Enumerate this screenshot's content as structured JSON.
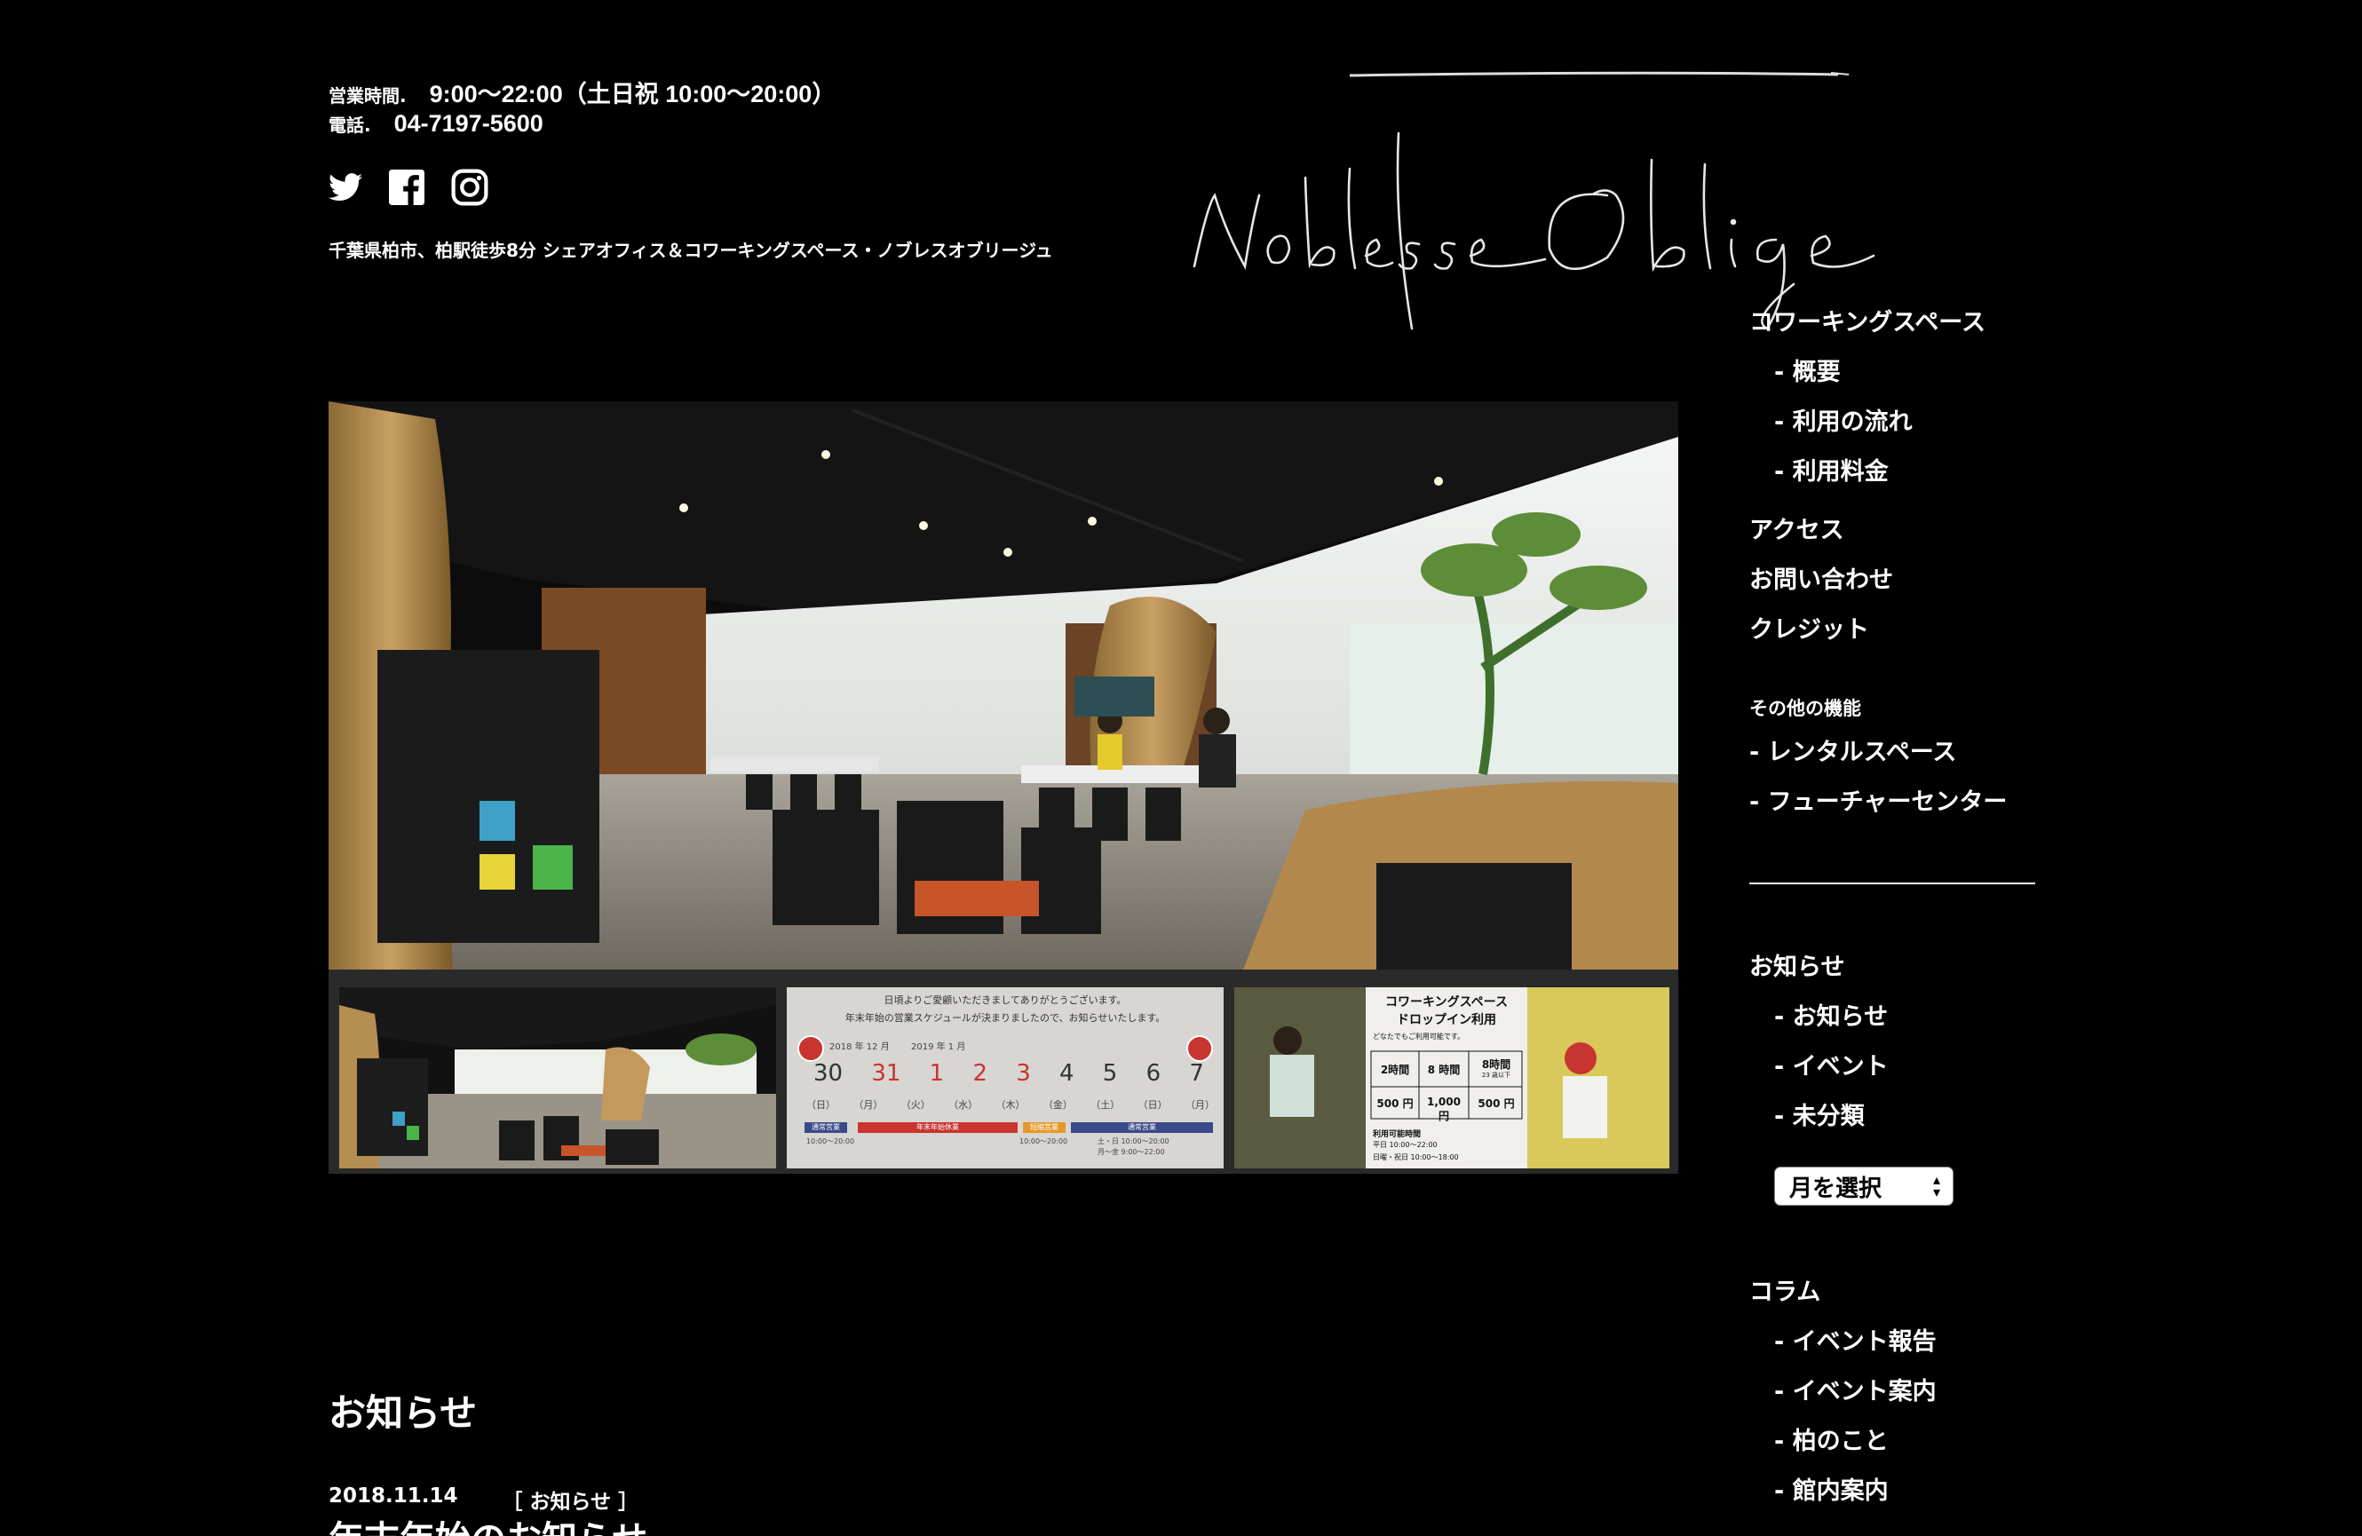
{
  "header": {
    "hours_label": "営業時間.",
    "hours_value": "9:00〜22:00（土日祝 10:00〜20:00）",
    "phone_label": "電話.",
    "phone_value": "04-7197-5600",
    "tagline": "千葉県柏市、柏駅徒歩8分 シェアオフィス＆コワーキングスペース・ノブレスオブリージュ",
    "social_icons": [
      "twitter-icon",
      "facebook-icon",
      "instagram-icon"
    ]
  },
  "logo": {
    "text": "Noblesse Oblige"
  },
  "sidebar": {
    "coworking": "コワーキングスペース",
    "coworking_items": [
      "- 概要",
      "- 利用の流れ",
      "- 利用料金"
    ],
    "access": "アクセス",
    "contact": "お問い合わせ",
    "credit": "クレジット",
    "other_heading": "その他の機能",
    "other_items": [
      "- レンタルスペース",
      "- フューチャーセンター"
    ],
    "news_heading": "お知らせ",
    "news_items": [
      "- お知らせ",
      "- イベント",
      "- 未分類"
    ],
    "month_select": "月を選択",
    "column_heading": "コラム",
    "column_items": [
      "- イベント報告",
      "- イベント案内",
      "- 柏のこと",
      "- 館内案内"
    ]
  },
  "slideshow": {
    "notice": {
      "line1": "日頃よりご愛顧いただきましてありがとうございます。",
      "line2": "年末年始の営業スケジュールが決まりましたので、お知らせいたします。",
      "year1": "2018 年 12 月",
      "year2": "2019 年 1 月",
      "days": [
        "30",
        "31",
        "1",
        "2",
        "3",
        "4",
        "5",
        "6",
        "7"
      ],
      "weekdays": [
        "（日）",
        "（月）",
        "（火）",
        "（水）",
        "（木）",
        "（金）",
        "（土）",
        "（日）",
        "（月）"
      ],
      "tag_normal": "通常営業",
      "tag_closed": "年末年始休業",
      "tag_short": "短縮営業",
      "hours_a": "10:00〜20:00",
      "hours_b": "10:00〜20:00",
      "hours_c": "土・日 10:00〜20:00",
      "hours_d": "月〜金 9:00〜22:00"
    },
    "dropin": {
      "title1": "コワーキングスペース",
      "title2": "ドロップイン利用",
      "subtitle": "どなたでもご利用可能です。",
      "col1": "2時間",
      "col2": "8 時間",
      "col3": "8時間",
      "col3_sub": "23 歳以下",
      "price1": "500 円",
      "price2": "1,000 円",
      "price3": "500 円",
      "hours_title": "利用可能時間",
      "hours1": "平日 10:00〜22:00",
      "hours2": "日曜・祝日 10:00〜18:00"
    }
  },
  "news": {
    "title": "お知らせ",
    "date": "2018.11.14",
    "category": "［ お知らせ ］",
    "post_title": "年末年始のお知らせ"
  },
  "colors": {
    "background": "#000000",
    "text": "#ffffff",
    "thumb_bg": "#2a2a2a"
  }
}
